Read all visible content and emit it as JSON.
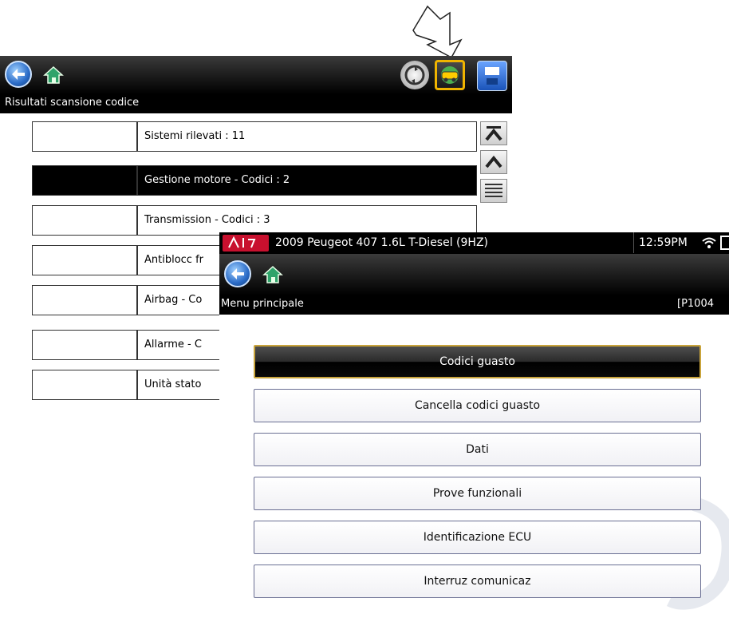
{
  "back": {
    "title": "Risultati scansione codice",
    "rows": [
      {
        "label": "Sistemi rilevati : 11"
      },
      {
        "label": "Gestione motore - Codici : 2"
      },
      {
        "label": "Transmission - Codici : 3"
      },
      {
        "label": "Antiblocc fr"
      },
      {
        "label": "Airbag - Co"
      },
      {
        "label": "Allarme - C"
      },
      {
        "label": "Unità stato"
      }
    ],
    "toolbar_icons": [
      "back-icon",
      "home-icon",
      "recycle-icon",
      "vehicle-connection-icon",
      "save-icon"
    ]
  },
  "front": {
    "status": {
      "vehicle": "2009 Peugeot 407 1.6L T-Diesel (9HZ)",
      "time": "12:59PM"
    },
    "title": "Menu principale",
    "code_hint": "[P1004",
    "menu": [
      {
        "label": "Codici guasto"
      },
      {
        "label": "Cancella codici guasto"
      },
      {
        "label": "Dati"
      },
      {
        "label": "Prove funzionali"
      },
      {
        "label": "Identificazione ECU"
      },
      {
        "label": "Interruz comunicaz"
      }
    ],
    "toolbar_icons": [
      "back-icon",
      "home-icon"
    ]
  },
  "colors": {
    "highlight_border": "#c9a43b",
    "menu_border": "#6a6f93",
    "status_logo_red": "#c8102e"
  }
}
